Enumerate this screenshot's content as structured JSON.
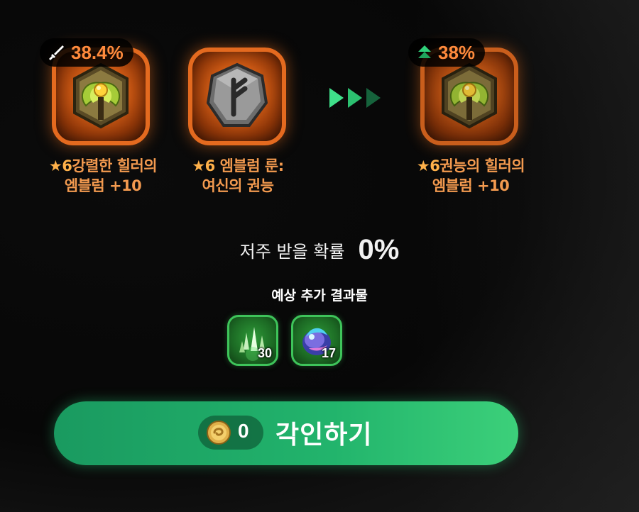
{
  "materials": {
    "main_item": {
      "grade": "★6",
      "name_line1": "강렬한 힐러의",
      "name_line2": "엠블럼 +10",
      "badge_icon": "sword-icon",
      "badge_value": "38.4%"
    },
    "rune_item": {
      "grade": "★6",
      "name_line1": "엠블럼 룬:",
      "name_line2": "여신의 권능"
    }
  },
  "result_item": {
    "grade": "★6",
    "name_line1": "권능의 힐러의",
    "name_line2": "엠블럼 +10",
    "badge_icon": "upgrade-arrow-icon",
    "badge_value": "38%"
  },
  "curse": {
    "label": "저주 받을 확률",
    "value": "0%"
  },
  "extra_results": {
    "title": "예상 추가 결과물",
    "items": [
      {
        "icon": "green-crystal-shards-icon",
        "count": "30"
      },
      {
        "icon": "blue-magic-stone-icon",
        "count": "17"
      }
    ]
  },
  "engrave_button": {
    "cost_icon": "gold-coin-icon",
    "cost": "0",
    "label": "각인하기"
  },
  "colors": {
    "card_orange": "#e46a1f",
    "label_orange": "#f39a4f",
    "accent_green": "#22b46c"
  }
}
